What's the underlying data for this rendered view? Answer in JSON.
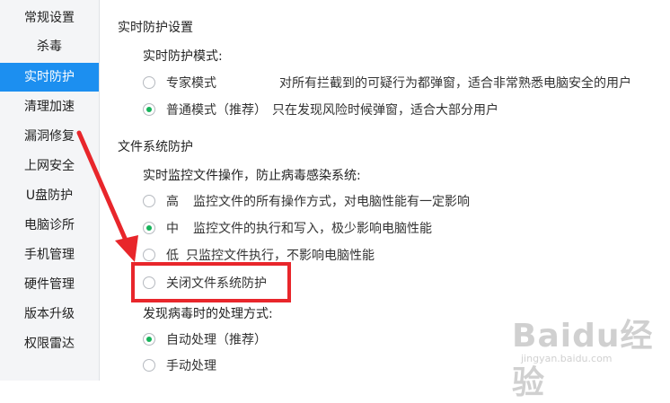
{
  "sidebar": {
    "items": [
      {
        "label": "常规设置",
        "active": false
      },
      {
        "label": "杀毒",
        "active": false
      },
      {
        "label": "实时防护",
        "active": true
      },
      {
        "label": "清理加速",
        "active": false
      },
      {
        "label": "漏洞修复",
        "active": false
      },
      {
        "label": "上网安全",
        "active": false
      },
      {
        "label": "U盘防护",
        "active": false
      },
      {
        "label": "电脑诊所",
        "active": false
      },
      {
        "label": "手机管理",
        "active": false
      },
      {
        "label": "硬件管理",
        "active": false
      },
      {
        "label": "版本升级",
        "active": false
      },
      {
        "label": "权限雷达",
        "active": false
      }
    ]
  },
  "realtime": {
    "title": "实时防护设置",
    "mode_label": "实时防护模式:",
    "options": [
      {
        "label": "专家模式",
        "desc": "对所有拦截到的可疑行为都弹窗，适合非常熟悉电脑安全的用户",
        "selected": false
      },
      {
        "label": "普通模式（推荐）",
        "desc": "只在发现风险时候弹窗，适合大部分用户",
        "selected": true
      }
    ]
  },
  "filesystem": {
    "title": "文件系统防护",
    "monitor_label": "实时监控文件操作，防止病毒感染系统:",
    "options": [
      {
        "label": "高",
        "desc": "监控文件的所有操作方式，对电脑性能有一定影响",
        "selected": false
      },
      {
        "label": "中",
        "desc": "监控文件的执行和写入，极少影响电脑性能",
        "selected": true
      },
      {
        "label": "低",
        "desc": "只监控文件执行，不影响电脑性能",
        "selected": false
      },
      {
        "label": "关闭文件系统防护",
        "desc": "",
        "selected": false
      }
    ],
    "virus_label": "发现病毒时的处理方式:",
    "virus_options": [
      {
        "label": "自动处理（推荐）",
        "selected": true
      },
      {
        "label": "手动处理",
        "selected": false
      }
    ]
  },
  "watermark": {
    "logo": "Baidu经验",
    "url": "jingyan.baidu.com"
  },
  "colors": {
    "accent": "#1c8ff0",
    "radio_on": "#16b35a",
    "highlight": "#e8262b"
  }
}
